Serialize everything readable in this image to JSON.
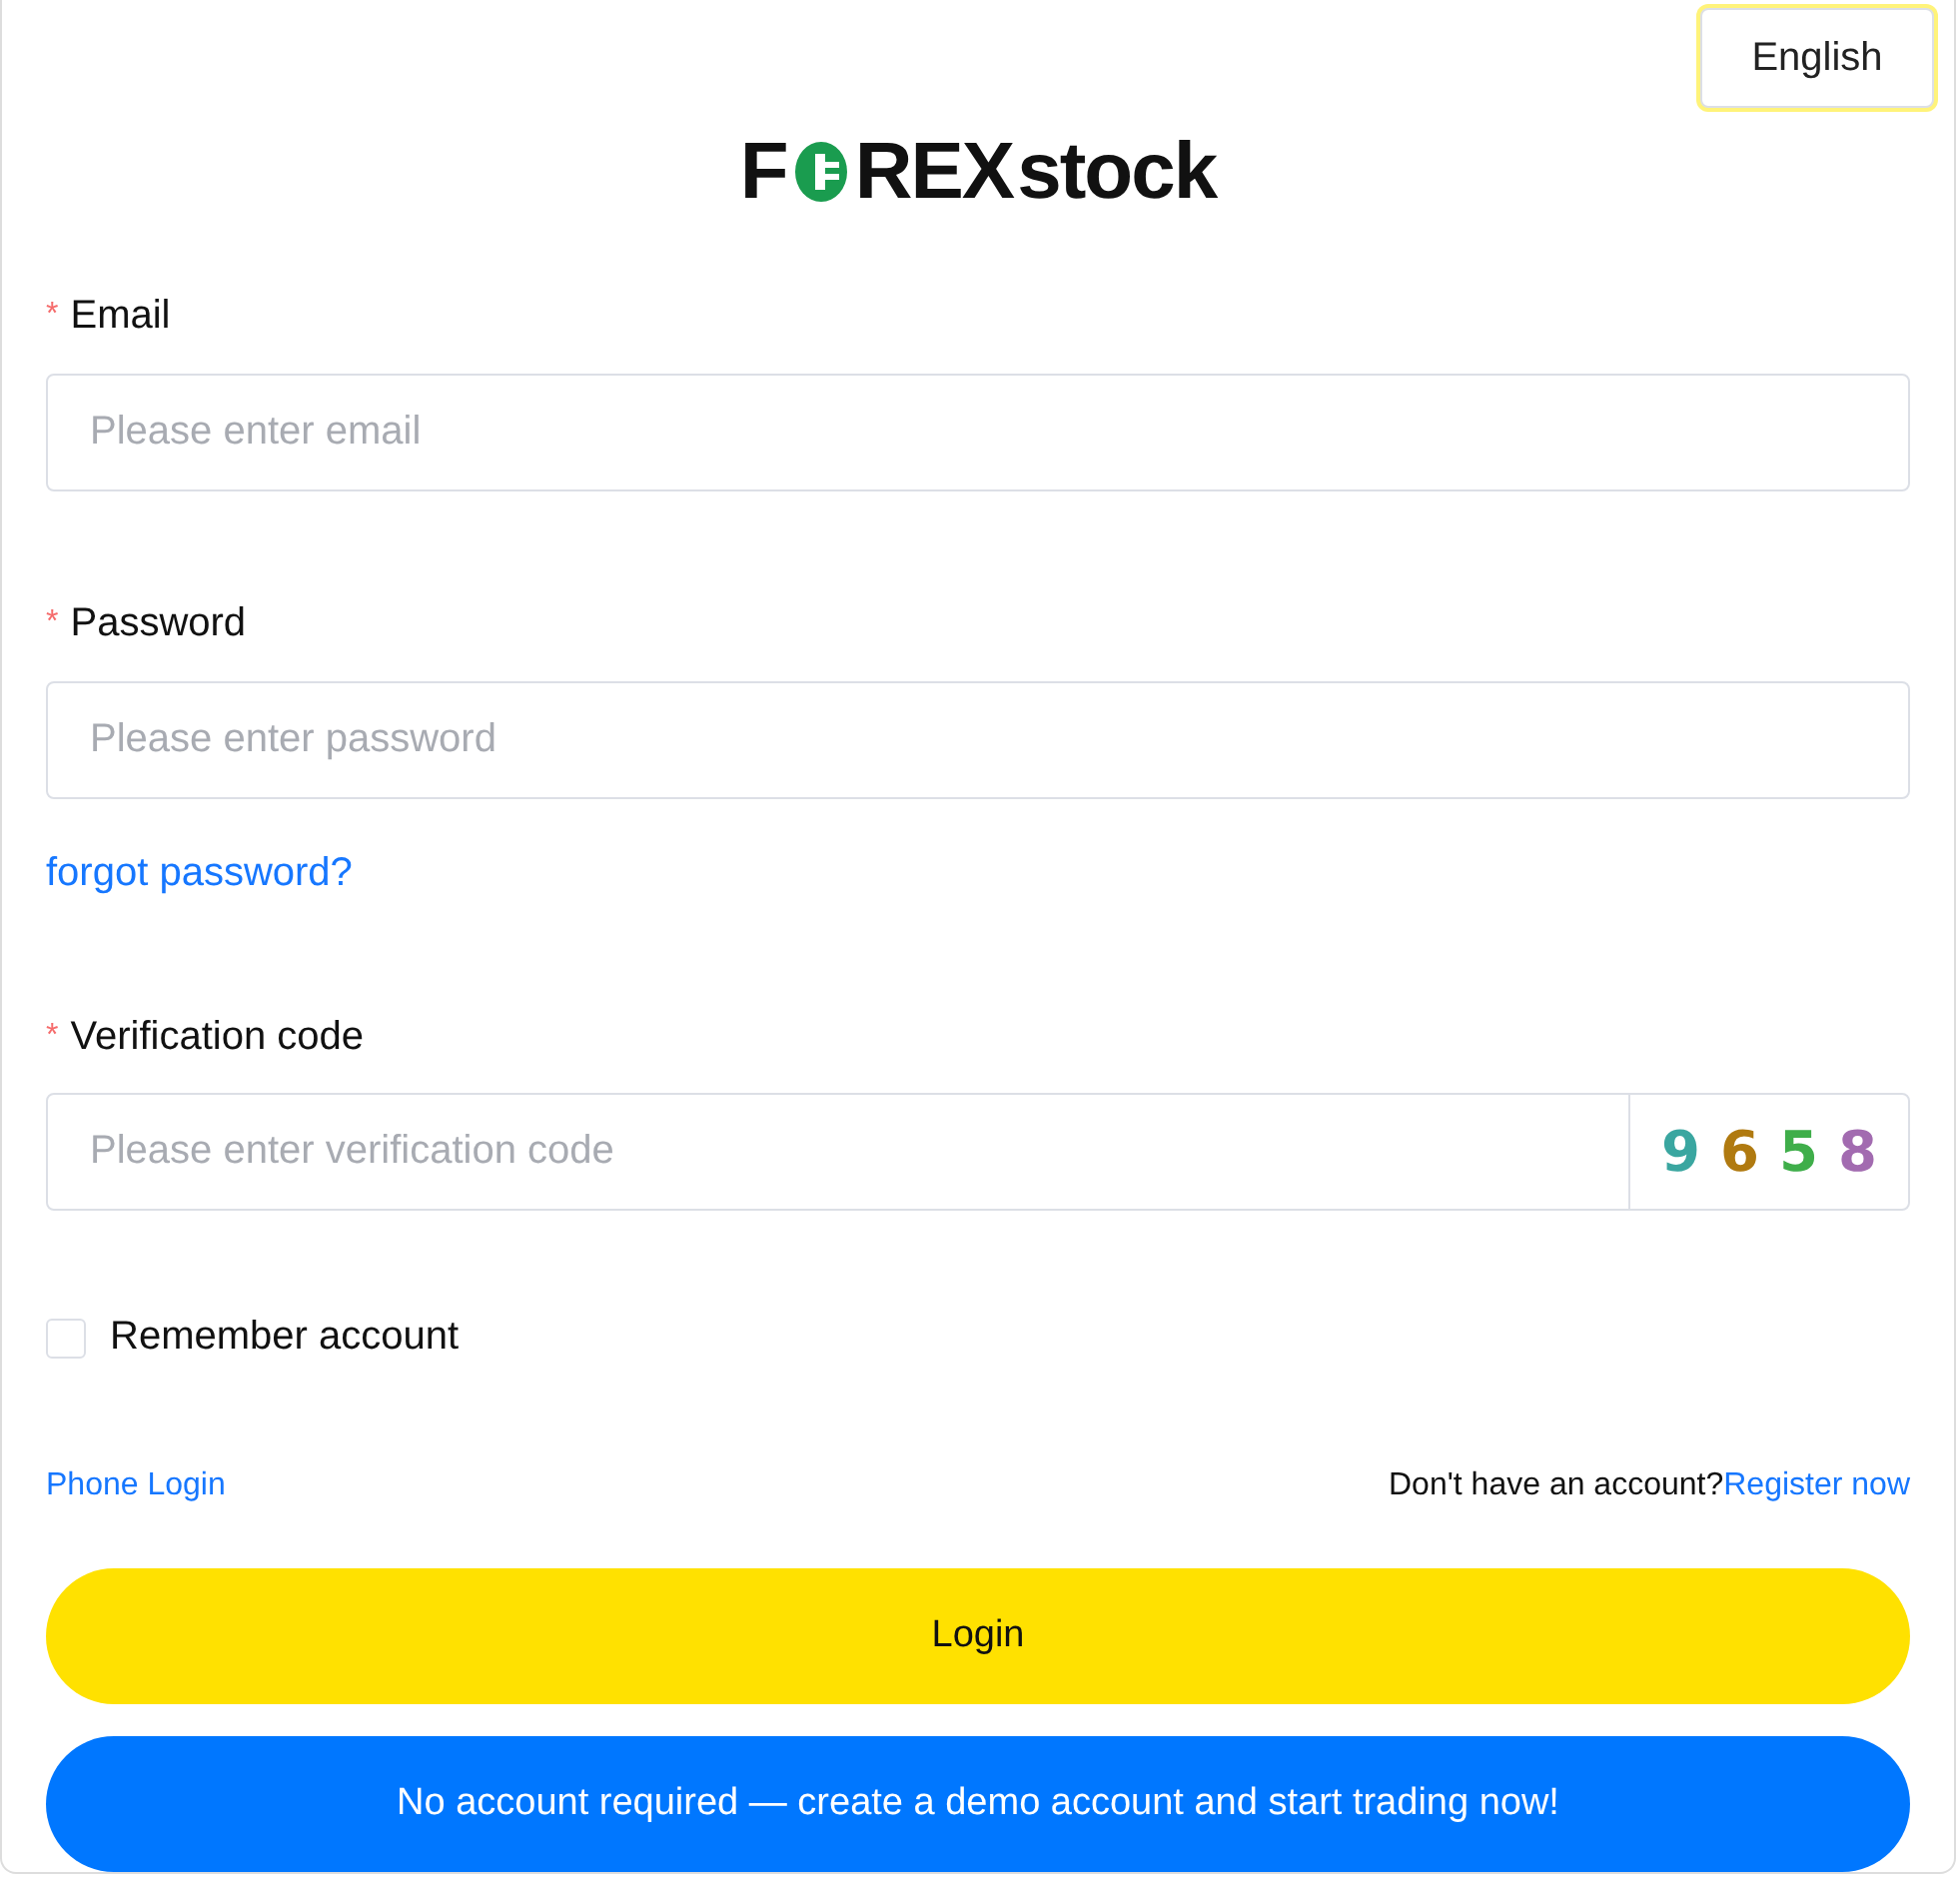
{
  "language_button": {
    "label": "English"
  },
  "logo": {
    "lead": "F",
    "rest": "REX",
    "suffix": "stock"
  },
  "fields": [
    {
      "label": "Email",
      "marker": "*",
      "placeholder": "Please enter email"
    },
    {
      "label": "Password",
      "marker": "*",
      "placeholder": "Please enter password"
    }
  ],
  "forgot_link": "forgot password?",
  "verification": {
    "label": "Verification code",
    "marker": "*",
    "placeholder": "Please enter verification code",
    "captcha": [
      {
        "char": "9",
        "color": "#3aa6a0"
      },
      {
        "char": "6",
        "color": "#b07a10"
      },
      {
        "char": "5",
        "color": "#3fae4a"
      },
      {
        "char": "8",
        "color": "#a26bb0"
      }
    ]
  },
  "remember": {
    "label": "Remember account",
    "checked": false
  },
  "phone_login": "Phone Login",
  "register": {
    "prompt": "Don't have an account?",
    "link": "Register now"
  },
  "buttons": [
    {
      "label": "Login",
      "kind": "primary"
    },
    {
      "label": "No account required — create a demo account and start trading now!",
      "kind": "demo"
    }
  ]
}
